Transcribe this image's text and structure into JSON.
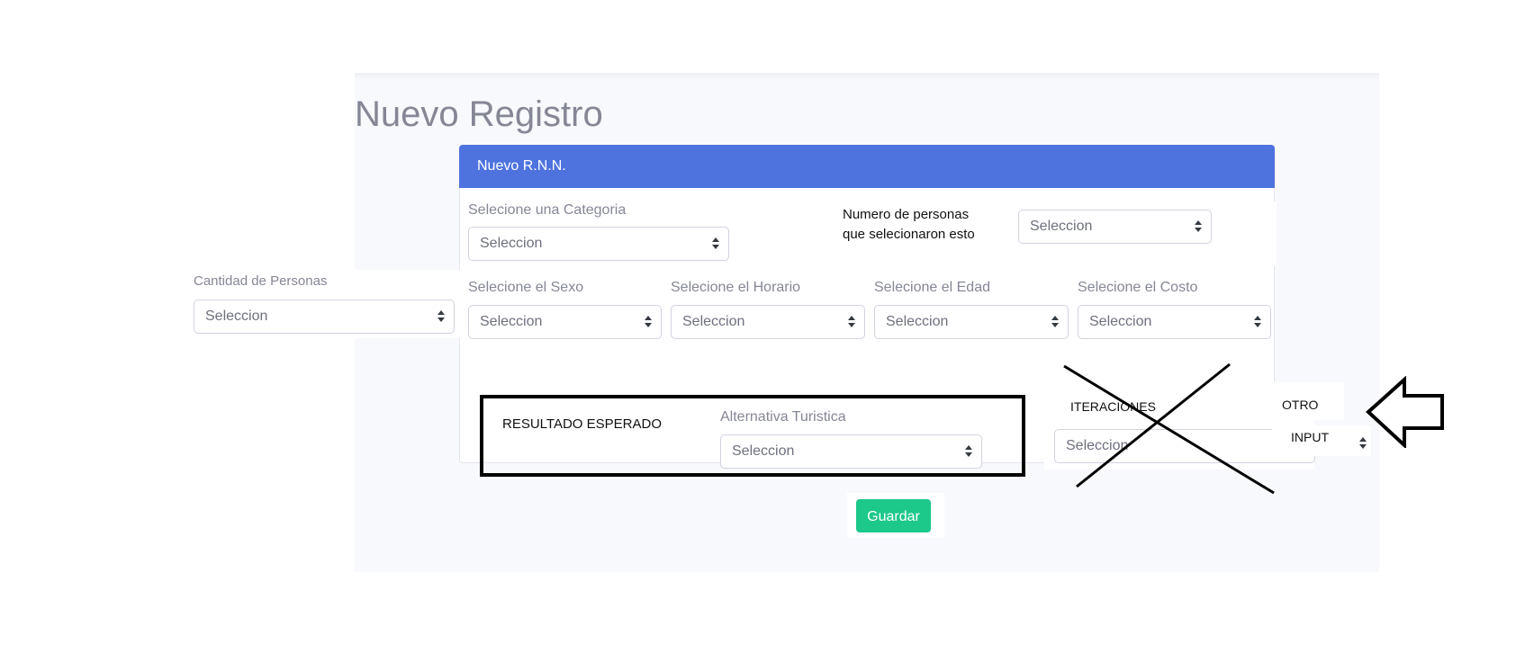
{
  "page": {
    "title": "Nuevo Registro"
  },
  "card": {
    "header": "Nuevo R.N.N."
  },
  "placeholder": "Seleccion",
  "fields": {
    "categoria": {
      "label": "Selecione una Categoria",
      "value": "Seleccion"
    },
    "numero_personas": {
      "label_line1": "Numero de personas",
      "label_line2": "que selecionaron esto",
      "value": "Seleccion"
    },
    "cantidad_personas": {
      "label": "Cantidad de Personas",
      "value": "Seleccion"
    },
    "sexo": {
      "label": "Selecione el Sexo",
      "value": "Seleccion"
    },
    "horario": {
      "label": "Selecione el Horario",
      "value": "Seleccion"
    },
    "edad": {
      "label": "Selecione el Edad",
      "value": "Seleccion"
    },
    "costo": {
      "label": "Selecione el Costo",
      "value": "Seleccion"
    },
    "alternativa": {
      "label": "Alternativa Turistica",
      "value": "Seleccion"
    },
    "iteraciones": {
      "label": "ITERACIONES",
      "value": "Seleccion"
    }
  },
  "annotations": {
    "resultado": "RESULTADO ESPERADO",
    "otro": "OTRO",
    "input": "INPUT"
  },
  "actions": {
    "save": "Guardar"
  },
  "colors": {
    "header": "#4e73df",
    "save": "#1cc88a",
    "title": "#858796"
  },
  "icons": [
    "select-caret-icon",
    "arrow-left-icon",
    "cross-out-icon"
  ]
}
